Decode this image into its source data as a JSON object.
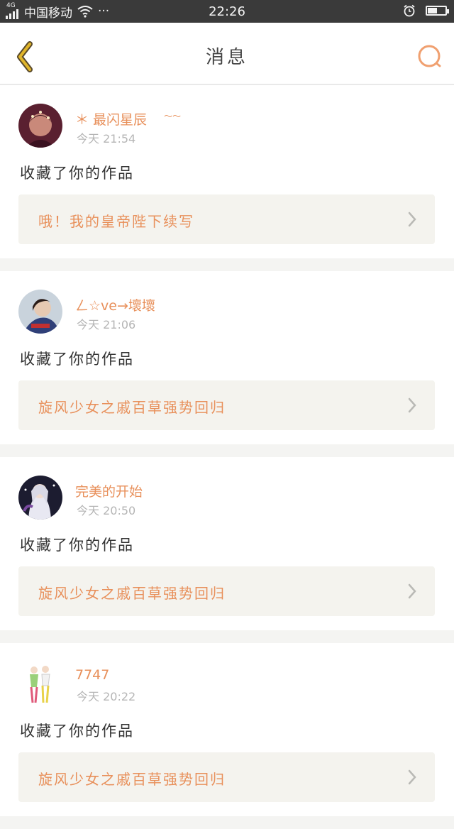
{
  "status_bar": {
    "network": "4G",
    "carrier": "中国移动",
    "dots": "···",
    "time": "22:26",
    "battery_level": 0.55
  },
  "header": {
    "title": "消息",
    "back_icon": "chevron-left-icon",
    "search_icon": "search-icon"
  },
  "colors": {
    "accent": "#e8905b",
    "back_icon": "#e0b52a",
    "background": "#f4f4f2"
  },
  "messages": [
    {
      "username": "＊ 最闪星辰",
      "username_suffix": "～～",
      "time": "今天  21:54",
      "action": "收藏了你的作品",
      "work_title": "哦！我的皇帝陛下续写"
    },
    {
      "username": "ㄥ☆ve→壞壞",
      "username_suffix": "",
      "time": "今天  21:06",
      "action": "收藏了你的作品",
      "work_title": "旋风少女之戚百草强势回归"
    },
    {
      "username": "完美的开始",
      "username_suffix": "",
      "time": "今天  20:50",
      "action": "收藏了你的作品",
      "work_title": "旋风少女之戚百草强势回归"
    },
    {
      "username": "7747",
      "username_suffix": "",
      "time": "今天  20:22",
      "action": "收藏了你的作品",
      "work_title": "旋风少女之戚百草强势回归"
    }
  ]
}
